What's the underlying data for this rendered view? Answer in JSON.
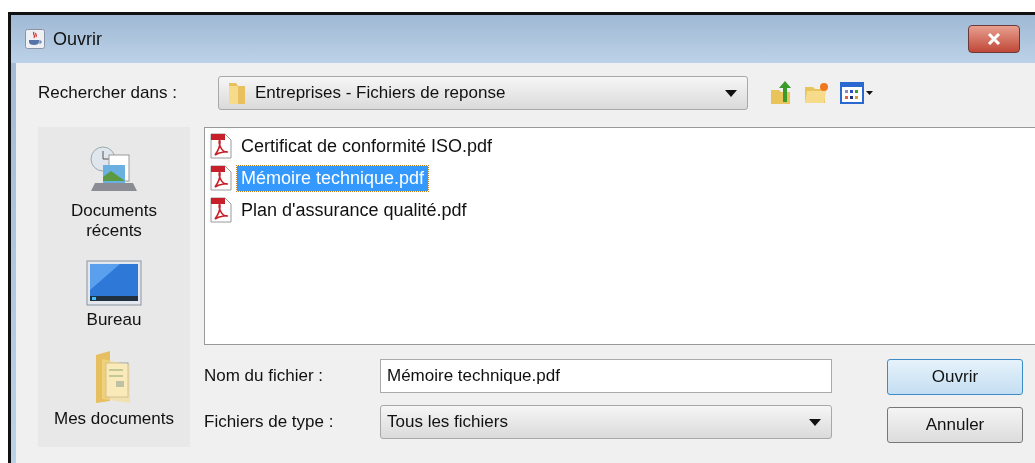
{
  "window": {
    "title": "Ouvrir"
  },
  "look_in": {
    "label": "Rechercher dans :",
    "value": "Entreprises - Fichiers de reponse"
  },
  "places": [
    {
      "kind": "recent",
      "label": "Documents récents"
    },
    {
      "kind": "desktop",
      "label": "Bureau"
    },
    {
      "kind": "documents",
      "label": "Mes documents"
    }
  ],
  "files": [
    {
      "name": "Certificat de conformité ISO.pdf",
      "selected": false
    },
    {
      "name": "Mémoire technique.pdf",
      "selected": true
    },
    {
      "name": "Plan d'assurance qualité.pdf",
      "selected": false
    }
  ],
  "file_name": {
    "label": "Nom du fichier :",
    "value": "Mémoire technique.pdf"
  },
  "file_type": {
    "label": "Fichiers de type :",
    "value": "Tous les fichiers"
  },
  "buttons": [
    {
      "label": "Ouvrir",
      "default": true
    },
    {
      "label": "Annuler",
      "default": false
    }
  ]
}
